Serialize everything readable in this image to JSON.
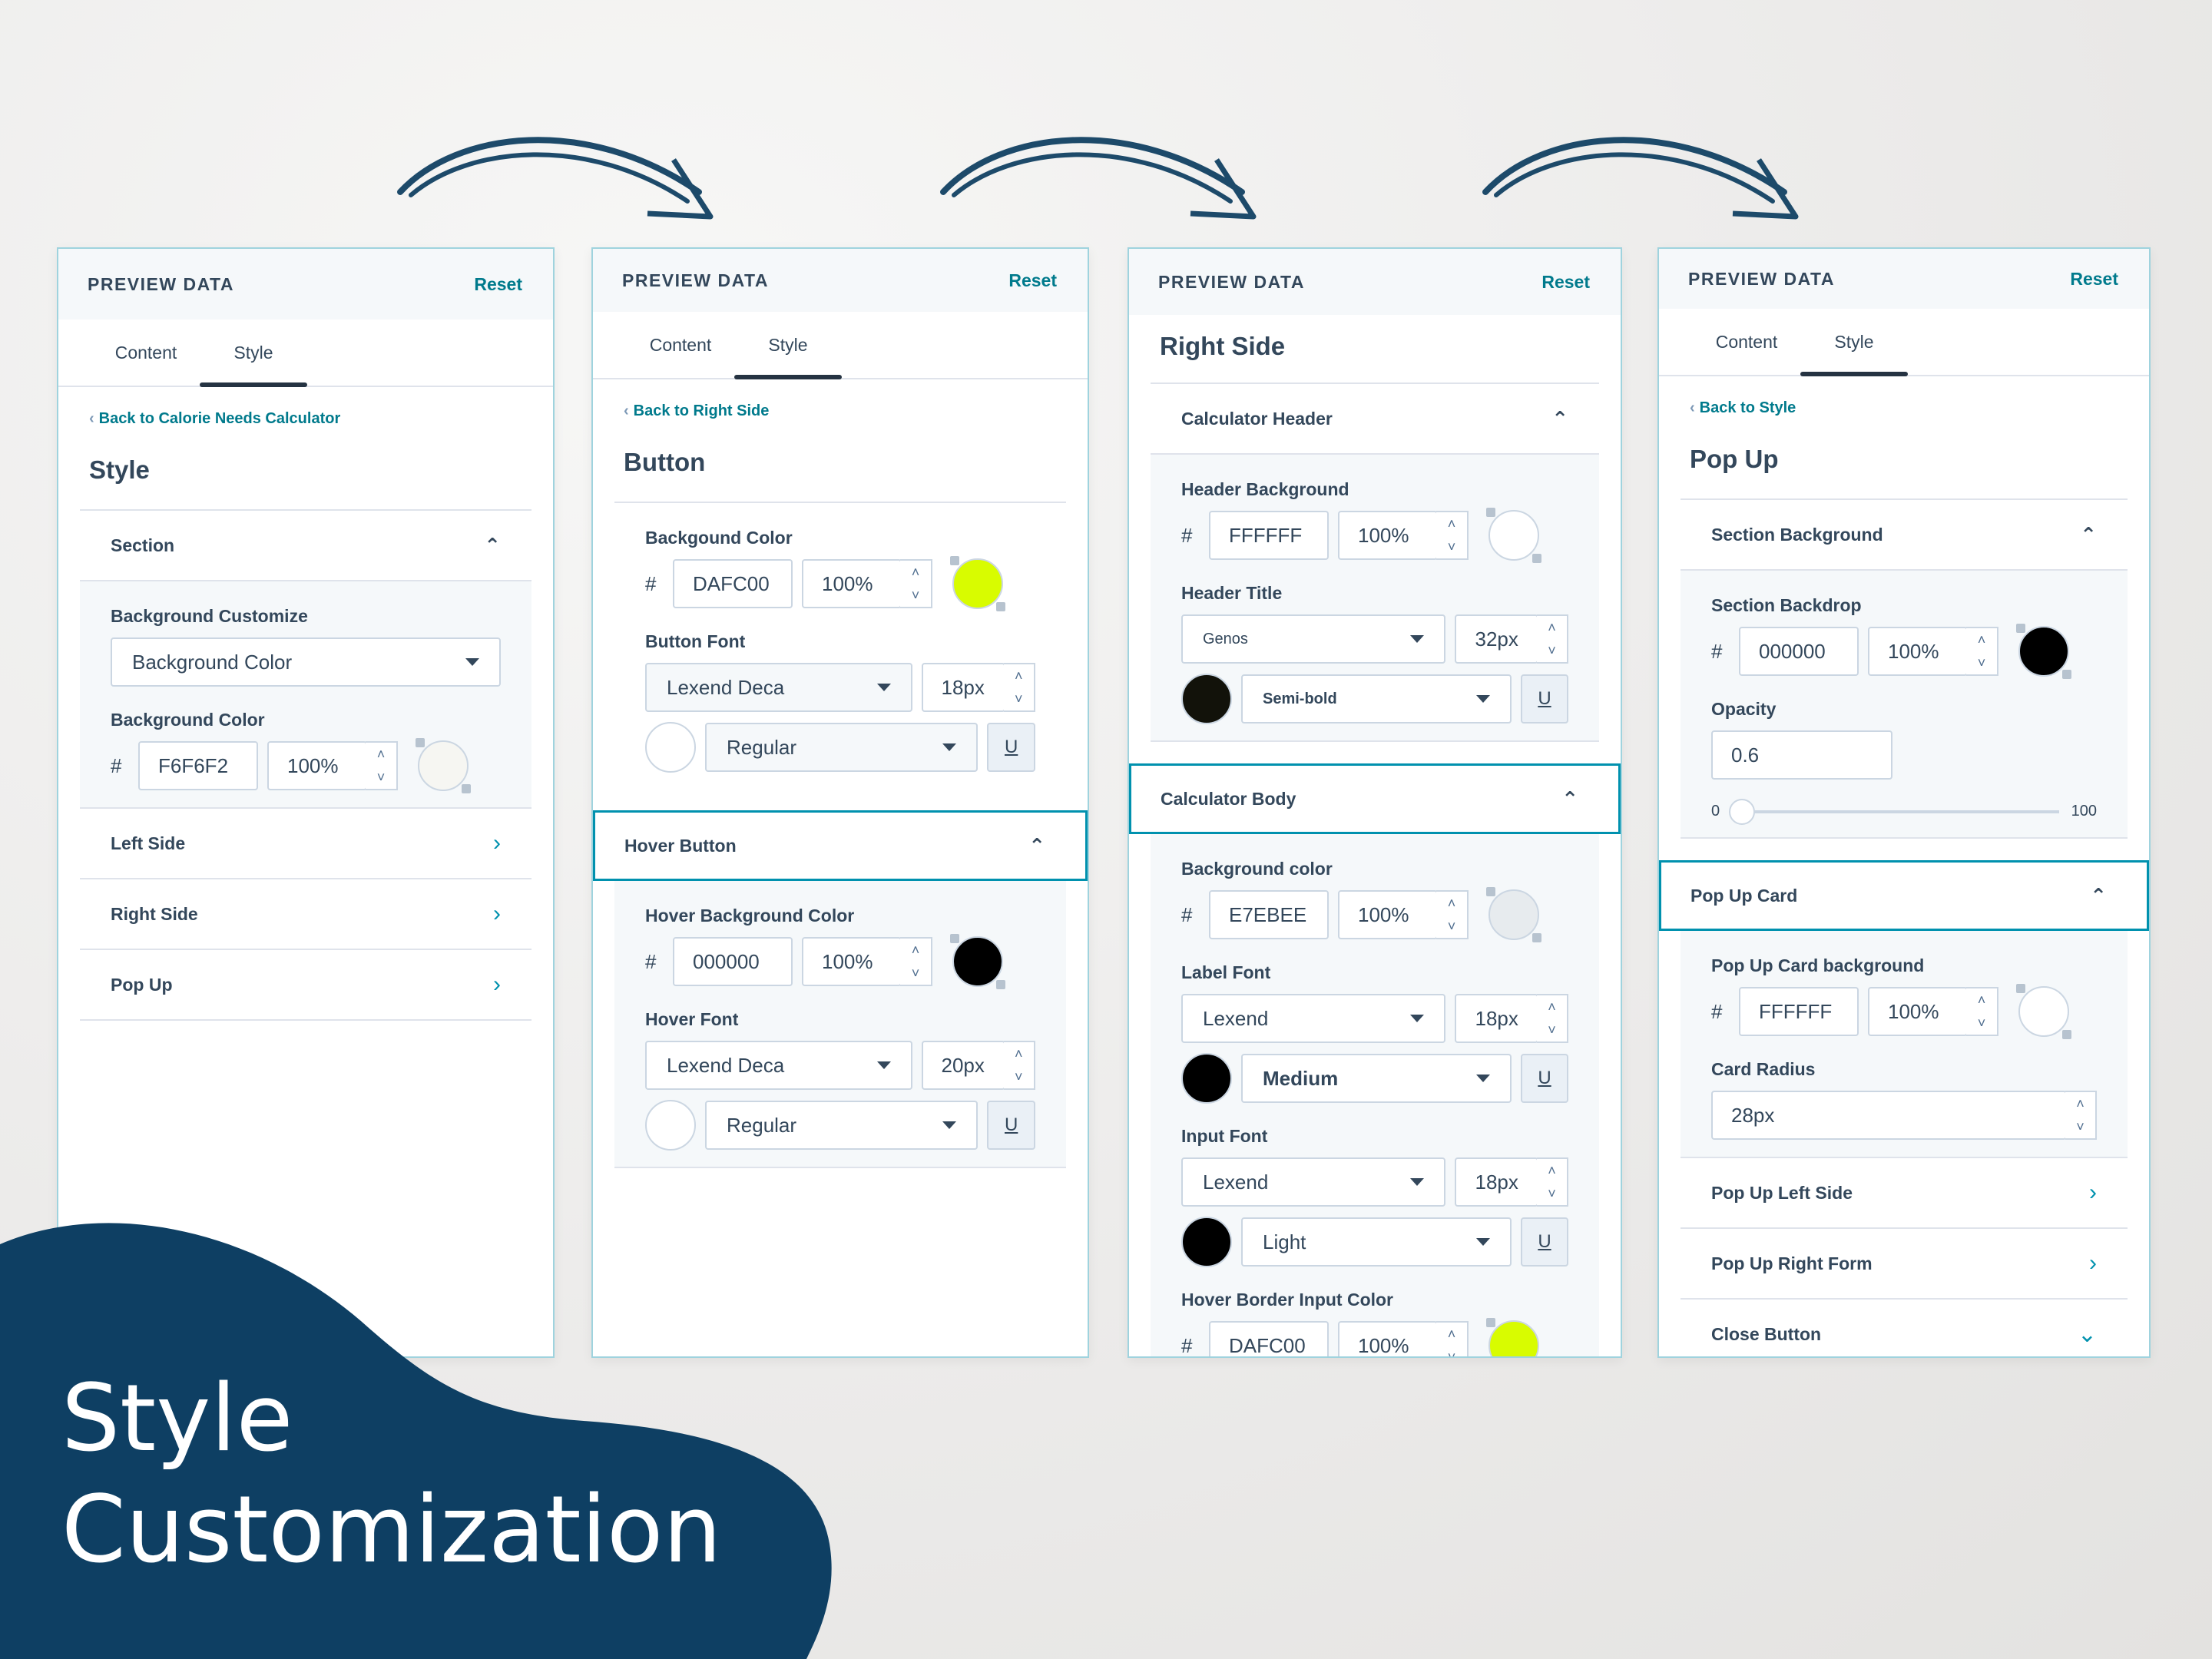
{
  "colors": {
    "accent": "#007a8c",
    "navy": "#0e3f63",
    "lime": "#d8fc00"
  },
  "hero_title": [
    "Style",
    "Customization"
  ],
  "panels": [
    {
      "header": "PREVIEW DATA",
      "reset": "Reset",
      "tabs": [
        "Content",
        "Style"
      ],
      "back": "Back to Calorie Needs Calculator",
      "title": "Style",
      "section": "Section",
      "bg_customize_label": "Background Customize",
      "bg_customize_value": "Background Color",
      "bg_color_label": "Background Color",
      "bg_color_hex": "F6F6F2",
      "bg_color_pct": "100%",
      "nav": [
        "Left Side",
        "Right Side",
        "Pop Up"
      ]
    },
    {
      "header": "PREVIEW DATA",
      "reset": "Reset",
      "tabs": [
        "Content",
        "Style"
      ],
      "back": "Back to Right Side",
      "title": "Button",
      "bg_label": "Backgound Color",
      "bg_hex": "DAFC00",
      "bg_pct": "100%",
      "font_label": "Button Font",
      "font": "Lexend Deca",
      "size": "18px",
      "weight": "Regular",
      "hover_section": "Hover Button",
      "hover_bg_label": "Hover Background Color",
      "hover_hex": "000000",
      "hover_pct": "100%",
      "hover_font_label": "Hover Font",
      "hover_font": "Lexend Deca",
      "hover_size": "20px",
      "hover_weight": "Regular"
    },
    {
      "header": "PREVIEW DATA",
      "reset": "Reset",
      "title": "Right Side",
      "calc_header": "Calculator Header",
      "hb_label": "Header Background",
      "hb_hex": "FFFFFF",
      "hb_pct": "100%",
      "ht_label": "Header Title",
      "ht_font": "Genos",
      "ht_size": "32px",
      "ht_weight": "Semi-bold",
      "calc_body": "Calculator Body",
      "body_bg_label": "Background color",
      "body_hex": "E7EBEE",
      "body_pct": "100%",
      "label_font_label": "Label Font",
      "label_font": "Lexend",
      "label_size": "18px",
      "label_weight": "Medium",
      "input_font_label": "Input Font",
      "input_font": "Lexend",
      "input_size": "18px",
      "input_weight": "Light",
      "hover_border_label": "Hover Border Input Color",
      "hover_border_hex": "DAFC00",
      "hover_border_pct": "100%"
    },
    {
      "header": "PREVIEW DATA",
      "reset": "Reset",
      "tabs": [
        "Content",
        "Style"
      ],
      "back": "Back to Style",
      "title": "Pop Up",
      "section_bg": "Section Background",
      "backdrop_label": "Section Backdrop",
      "backdrop_hex": "000000",
      "backdrop_pct": "100%",
      "opacity_label": "Opacity",
      "opacity_value": "0.6",
      "slider_min": "0",
      "slider_max": "100",
      "card_section": "Pop Up Card",
      "card_bg_label": "Pop Up Card background",
      "card_hex": "FFFFFF",
      "card_pct": "100%",
      "radius_label": "Card Radius",
      "radius_value": "28px",
      "nav": [
        "Pop Up Left Side",
        "Pop Up Right Form",
        "Close Button"
      ]
    }
  ]
}
